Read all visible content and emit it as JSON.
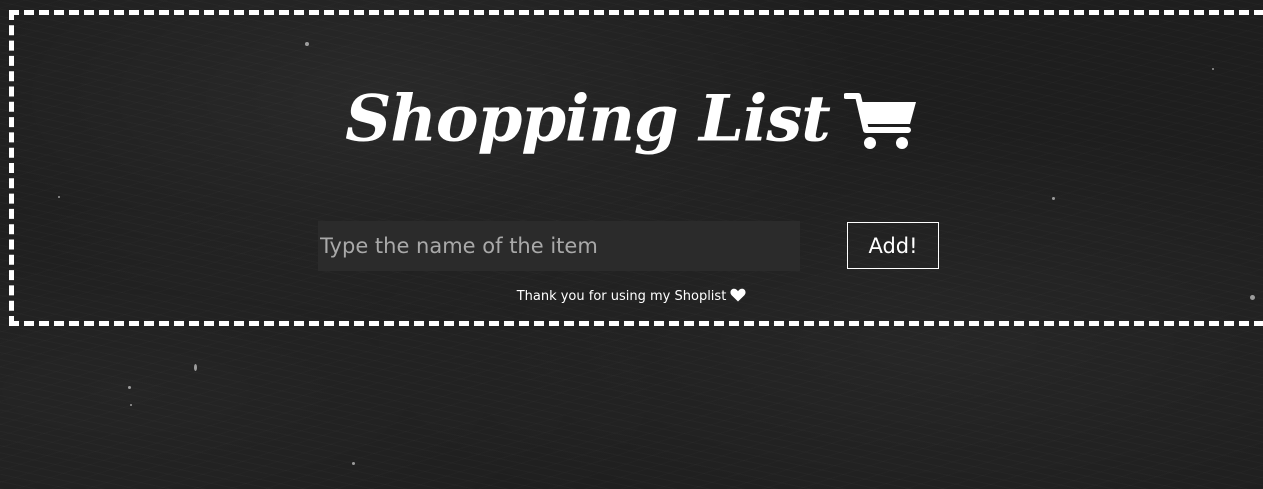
{
  "header": {
    "title": "Shopping List",
    "icon": "shopping-cart-icon"
  },
  "form": {
    "placeholder": "Type the name of the item",
    "value": "",
    "add_label": "Add!"
  },
  "footer": {
    "note": "Thank you for using my Shoplist",
    "icon": "heart-icon"
  },
  "colors": {
    "background": "#1e1e1e",
    "text": "#ffffff",
    "input_background": "#2b2b2b",
    "placeholder": "#a9a9a9",
    "frame": "#ffffff"
  }
}
